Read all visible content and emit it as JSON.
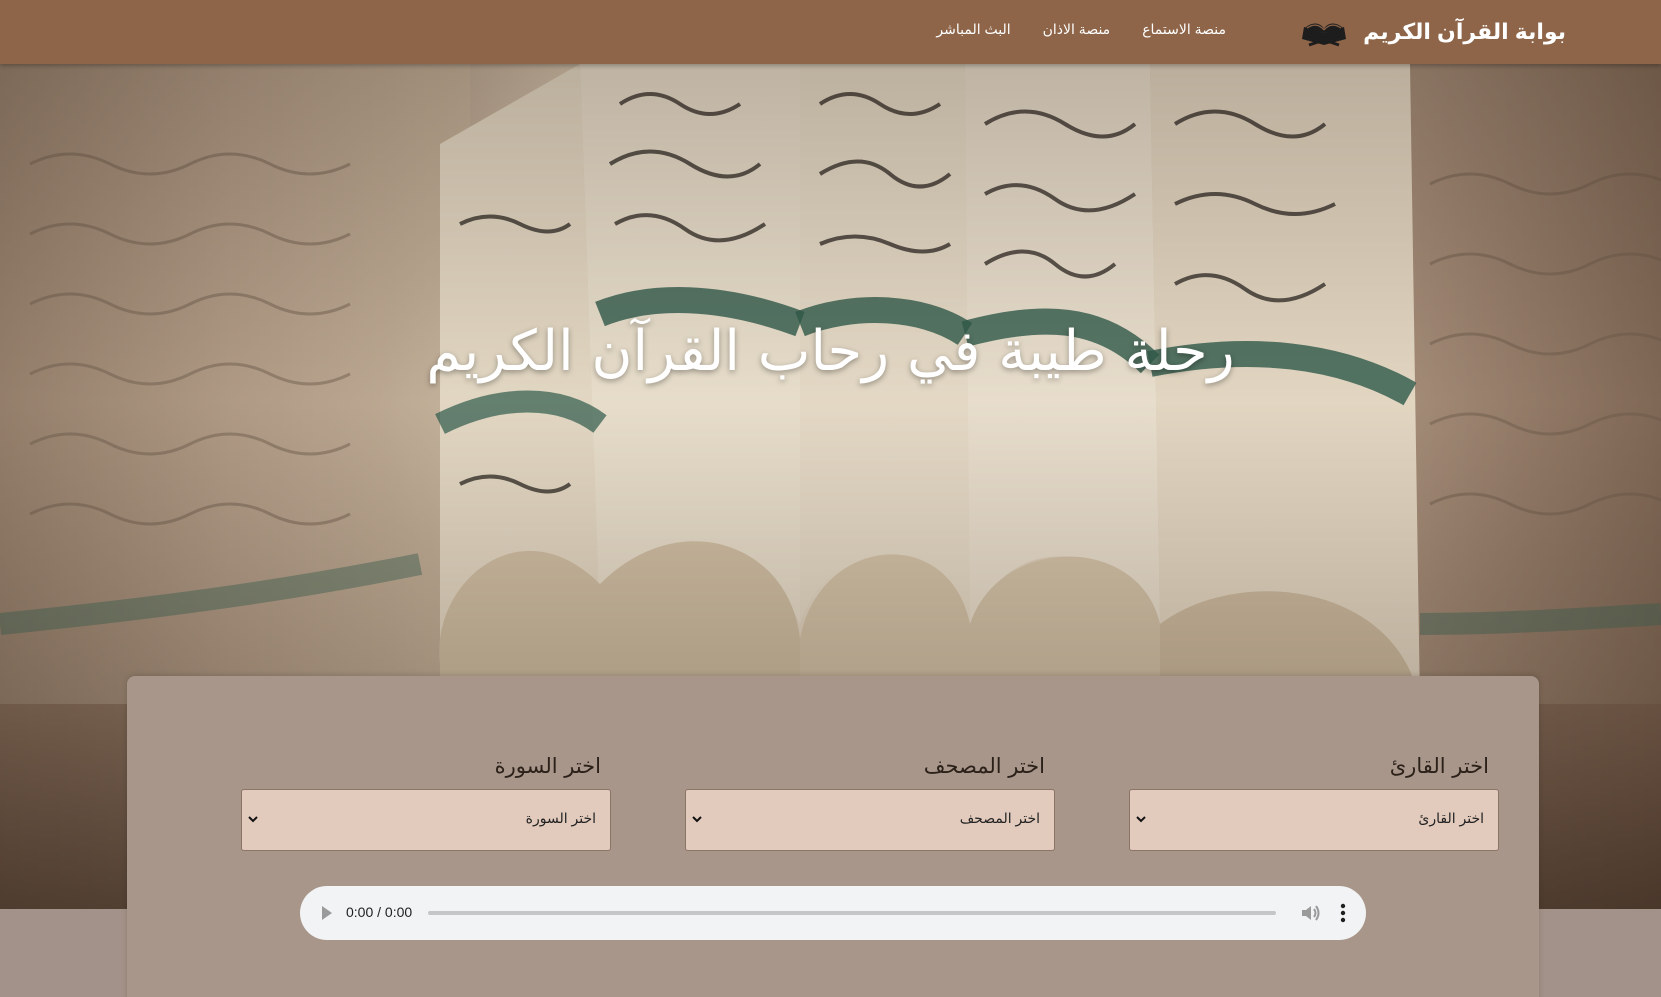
{
  "nav": {
    "brand": "بوابة القرآن الكريم",
    "brand_icon": "open-quran-icon",
    "links": [
      {
        "label": "منصة الاستماع"
      },
      {
        "label": "منصة الاذان"
      },
      {
        "label": "البث المباشر"
      }
    ]
  },
  "hero": {
    "title": "رحلة طيبة في رحاب القرآن الكريم"
  },
  "selectors": {
    "reciter": {
      "label": "اختر القارئ",
      "value": "اختر القارئ"
    },
    "mushaf": {
      "label": "اختر المصحف",
      "value": "اختر المصحف"
    },
    "surah": {
      "label": "اختر السورة",
      "value": "اختر السورة"
    }
  },
  "player": {
    "time": "0:00 / 0:00",
    "progress": 0
  },
  "colors": {
    "navbar": "#8e6549",
    "panel": "#a8968a",
    "select_bg": "#e2cbbd",
    "player_bg": "#f1f3f4"
  }
}
